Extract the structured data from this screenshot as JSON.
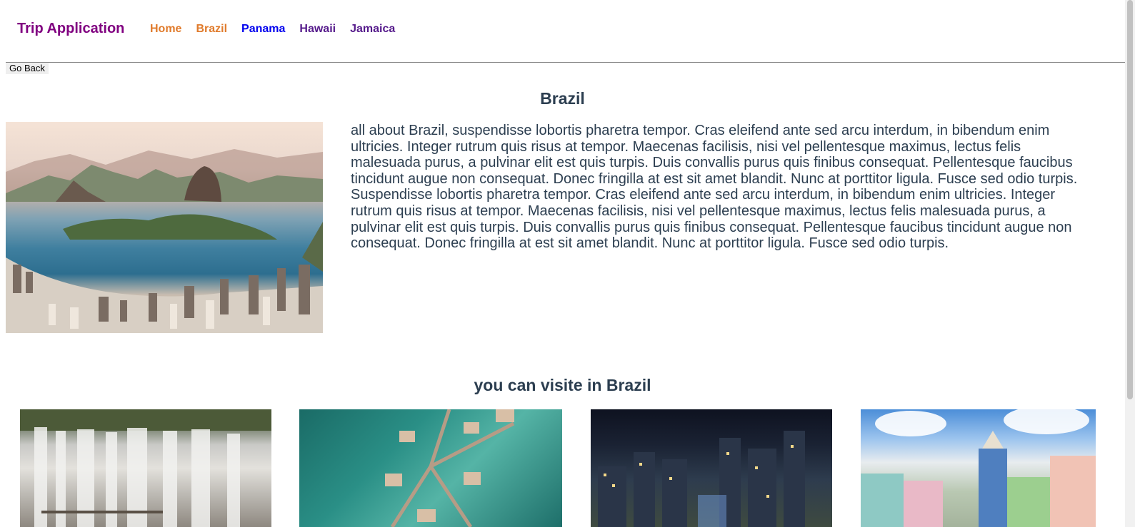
{
  "header": {
    "brand": "Trip Application",
    "nav": [
      "Home",
      "Brazil",
      "Panama",
      "Hawaii",
      "Jamaica"
    ]
  },
  "actions": {
    "go_back": "Go Back"
  },
  "main": {
    "title": "Brazil",
    "description": "all about Brazil, suspendisse lobortis pharetra tempor. Cras eleifend ante sed arcu interdum, in bibendum enim ultricies. Integer rutrum quis risus at tempor. Maecenas facilisis, nisi vel pellentesque maximus, lectus felis malesuada purus, a pulvinar elit est quis turpis. Duis convallis purus quis finibus consequat. Pellentesque faucibus tincidunt augue non consequat. Donec fringilla at est sit amet blandit. Nunc at porttitor ligula. Fusce sed odio turpis. Suspendisse lobortis pharetra tempor. Cras eleifend ante sed arcu interdum, in bibendum enim ultricies. Integer rutrum quis risus at tempor. Maecenas facilisis, nisi vel pellentesque maximus, lectus felis malesuada purus, a pulvinar elit est quis turpis. Duis convallis purus quis finibus consequat. Pellentesque faucibus tincidunt augue non consequat. Donec fringilla at est sit amet blandit. Nunc at porttitor ligula. Fusce sed odio turpis."
  },
  "gallery": {
    "title": "you can visite in Brazil"
  },
  "colors": {
    "brand": "#800080",
    "nav_active": "#e07b2c",
    "nav_link": "#0000ee",
    "nav_visited": "#551a8b",
    "text": "#2c3e50"
  }
}
